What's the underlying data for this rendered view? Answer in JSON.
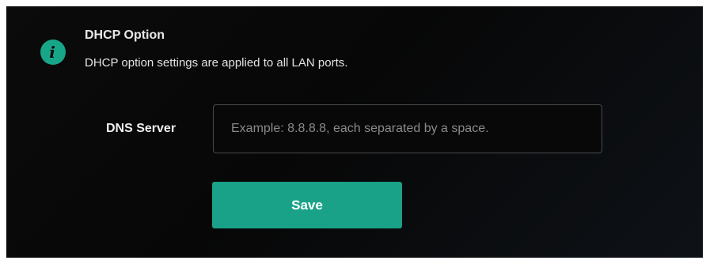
{
  "notice": {
    "icon": "info-icon",
    "icon_glyph": "i",
    "accent_color": "#18a689",
    "title": "DHCP Option",
    "description": "DHCP option settings are applied to all LAN ports."
  },
  "form": {
    "dns_server": {
      "label": "DNS Server",
      "value": "",
      "placeholder": "Example: 8.8.8.8, each separated by a space."
    },
    "save_label": "Save",
    "save_color": "#1aa288"
  }
}
